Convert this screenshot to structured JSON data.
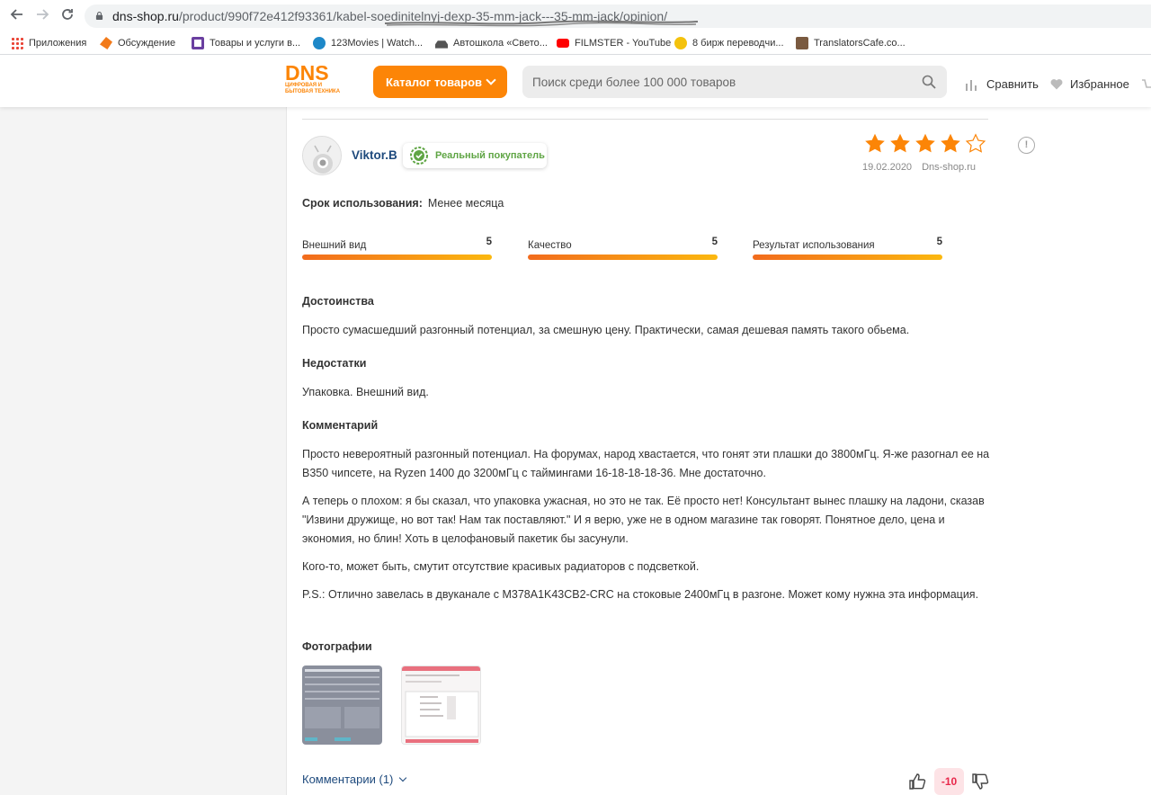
{
  "browser": {
    "url_domain": "dns-shop.ru",
    "url_path": "/product/990f72e412f93361/kabel-soedinitelnyj-dexp-35-mm-jack---35-mm-jack/opinion/",
    "bookmarks": [
      {
        "label": "Приложения",
        "icon": "apps-grid-icon",
        "color": "#4285f4"
      },
      {
        "label": "Обсуждение",
        "icon": "discussion-icon",
        "color": "#f27a1a"
      },
      {
        "label": "Товары и услуги в...",
        "icon": "shop-icon",
        "color": "#6a3fa0"
      },
      {
        "label": "123Movies | Watch...",
        "icon": "movie-icon",
        "color": "#1e88c8"
      },
      {
        "label": "Автошкола «Свето...",
        "icon": "car-icon",
        "color": "#555555"
      },
      {
        "label": "FILMSTER - YouTube",
        "icon": "youtube-icon",
        "color": "#ff0000"
      },
      {
        "label": "8 бирж переводчи...",
        "icon": "coin-icon",
        "color": "#f4c20d"
      },
      {
        "label": "TranslatorsCafe.co...",
        "icon": "translators-icon",
        "color": "#7a5a40"
      }
    ]
  },
  "header": {
    "logo_text": "DNS",
    "logo_subtitle": "ЦИФРОВАЯ И БЫТОВАЯ ТЕХНИКА",
    "catalog_label": "Каталог товаров",
    "search_placeholder": "Поиск среди более 100 000 товаров",
    "compare_label": "Сравнить",
    "favorites_label": "Избранное",
    "accent_color": "#fc8507"
  },
  "review": {
    "author": "Viktor.B",
    "badge": "Реальный покупатель",
    "stars": 4,
    "stars_max": 5,
    "date": "19.02.2020",
    "source": "Dns-shop.ru",
    "usage_label": "Срок использования:",
    "usage_value": "Менее месяца",
    "ratings": [
      {
        "name": "Внешний вид",
        "score": "5"
      },
      {
        "name": "Качество",
        "score": "5"
      },
      {
        "name": "Результат использования",
        "score": "5"
      }
    ],
    "pros_title": "Достоинства",
    "pros_text": "Просто сумасшедший разгонный потенциал, за смешную цену. Практически, самая дешевая память такого обьема.",
    "cons_title": "Недостатки",
    "cons_text": "Упаковка. Внешний вид.",
    "comment_title": "Комментарий",
    "comment_paragraphs": [
      "Просто невероятный разгонный потенциал. На форумах, народ хвастается, что гонят эти плашки до 3800мГц. Я-же разогнал ее на B350 чипсете, на Ryzen 1400 до 3200мГц с таймингами 16-18-18-18-36. Мне достаточно.",
      "А теперь о плохом: я бы сказал, что упаковка ужасная, но это не так. Её просто нет! Консультант вынес плашку на ладони, сказав \"Извини дружище, но вот так! Нам так поставляют.\" И я верю, уже не в одном магазине так говорят. Понятное дело, цена и экономия, но блин! Хоть в целофановый пакетик бы засунули.",
      "Кого-то, может быть, смутит отсутствие красивых радиаторов с подсветкой.",
      "P.S.: Отлично завелась в двуканале с M378A1K43CB2-CRC на стоковые 2400мГц в разгоне. Может кому нужна эта информация."
    ],
    "photos_title": "Фотографии",
    "comments_link": "Комментарии (1)",
    "vote_count": "-10"
  }
}
